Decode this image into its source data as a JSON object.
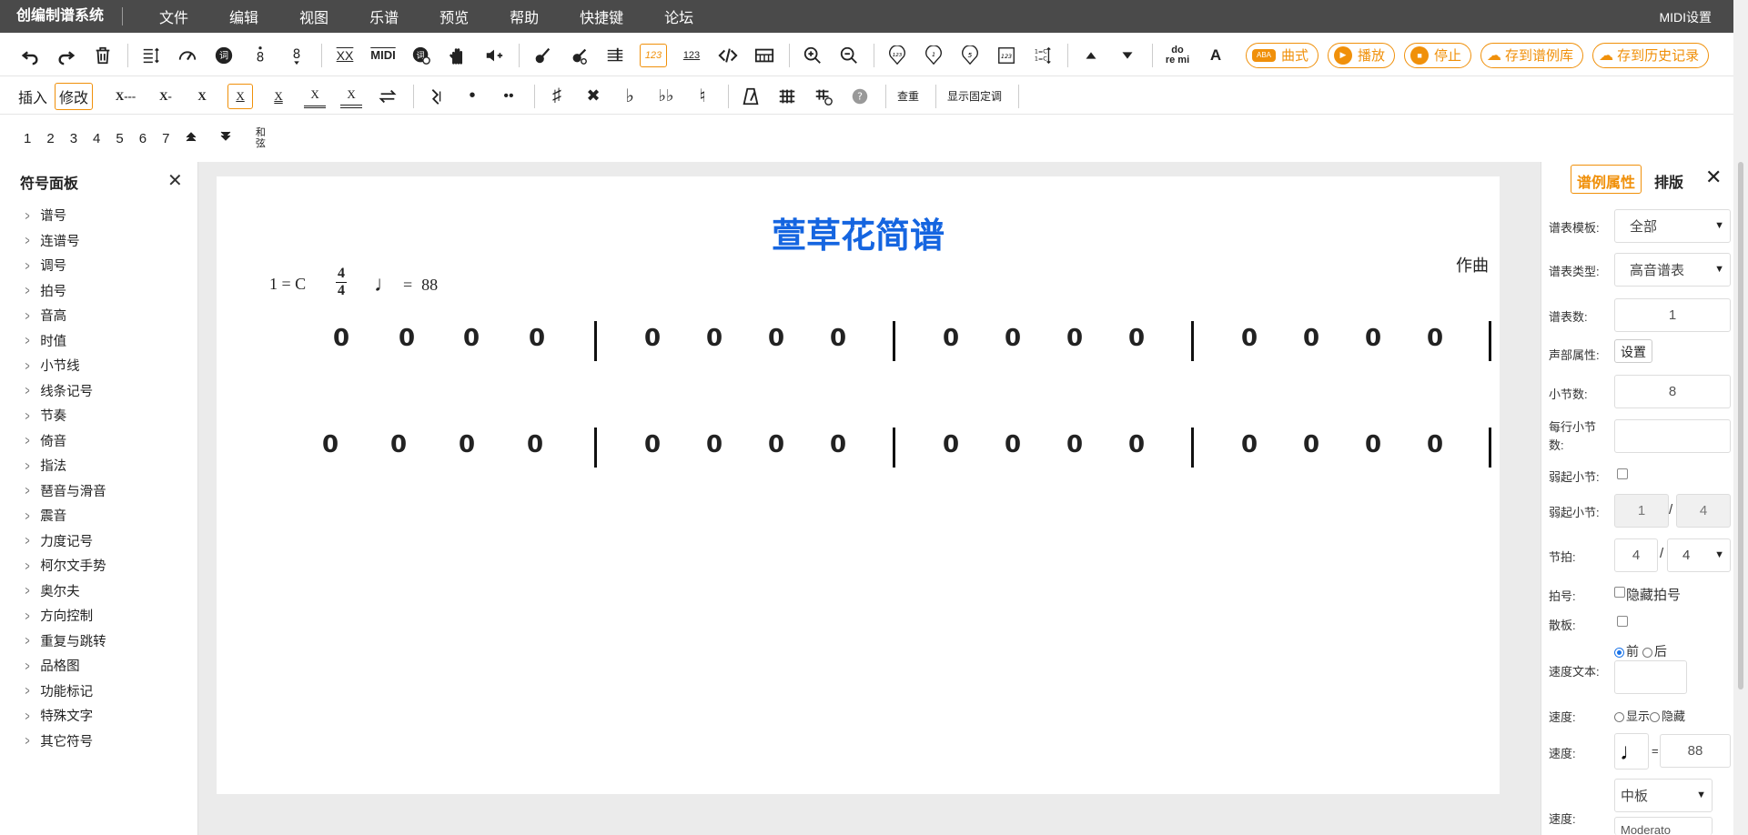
{
  "app": {
    "title": "创编制谱系统",
    "midi_settings": "MIDI设置"
  },
  "menu": [
    "文件",
    "编辑",
    "视图",
    "乐谱",
    "预览",
    "帮助",
    "快捷键",
    "论坛"
  ],
  "toolbar": {
    "tool_icons": [
      "undo-icon",
      "redo-icon",
      "delete-icon",
      "line-spacing-icon",
      "tempo-icon",
      "lyrics-icon",
      "octave-up-icon",
      "octave-down-icon"
    ],
    "xx_label": "XX",
    "midi_label": "MIDI",
    "badge_123": "123",
    "badge_123b": "123",
    "doremi": "do\nre mi",
    "font_a": "A",
    "btn_style": "曲式",
    "btn_play": "播放",
    "btn_stop": "停止",
    "btn_save_lib": "存到谱例库",
    "btn_save_history": "存到历史记录"
  },
  "toolbar2": {
    "insert": "插入",
    "modify": "修改",
    "durations": [
      "X---",
      "X-",
      "X",
      "X",
      "X",
      "X",
      "X"
    ],
    "check": "查重",
    "show_fixed": "显示固定调"
  },
  "toolbar3": {
    "numbers": [
      "1",
      "2",
      "3",
      "4",
      "5",
      "6",
      "7"
    ],
    "chord": "和弦"
  },
  "left_panel": {
    "title": "符号面板",
    "items": [
      "谱号",
      "连谱号",
      "调号",
      "拍号",
      "音高",
      "时值",
      "小节线",
      "线条记号",
      "节奏",
      "倚音",
      "指法",
      "琶音与滑音",
      "震音",
      "力度记号",
      "柯尔文手势",
      "奥尔夫",
      "方向控制",
      "重复与跳转",
      "品格图",
      "功能标记",
      "特殊文字",
      "其它符号"
    ]
  },
  "score": {
    "title": "萱草花简谱",
    "composer": "作曲",
    "key": "1 = C",
    "time_top": "4",
    "time_bottom": "4",
    "tempo_eq": "=",
    "tempo_value": "88",
    "rest_symbol": "0"
  },
  "right_panel": {
    "tab_props": "谱例属性",
    "tab_layout": "排版",
    "template_label": "谱表模板:",
    "template_value": "全部",
    "type_label": "谱表类型:",
    "type_value": "高音谱表",
    "count_label": "谱表数:",
    "count_value": "1",
    "voice_label": "声部属性:",
    "voice_btn": "设置",
    "measures_label": "小节数:",
    "measures_value": "8",
    "per_row_label": "每行小节数:",
    "per_row_value": "",
    "pickup_label": "弱起小节:",
    "pickup2_label": "弱起小节:",
    "pickup_num": "1",
    "pickup_slash": "/",
    "pickup_den": "4",
    "meter_label": "节拍:",
    "meter_num": "4",
    "meter_slash": "/",
    "meter_den": "4",
    "timesig_label": "拍号:",
    "hide_timesig": "隐藏拍号",
    "free_label": "散板:",
    "tempo_text_label": "速度文本:",
    "before": "前",
    "after": "后",
    "speed_label": "速度:",
    "show": "显示",
    "hide": "隐藏",
    "speed2_label": "速度:",
    "speed_eq": "=",
    "speed_value": "88",
    "speed3_label": "速度:",
    "speed_term": "中板",
    "speed_term_en": "Moderato"
  }
}
